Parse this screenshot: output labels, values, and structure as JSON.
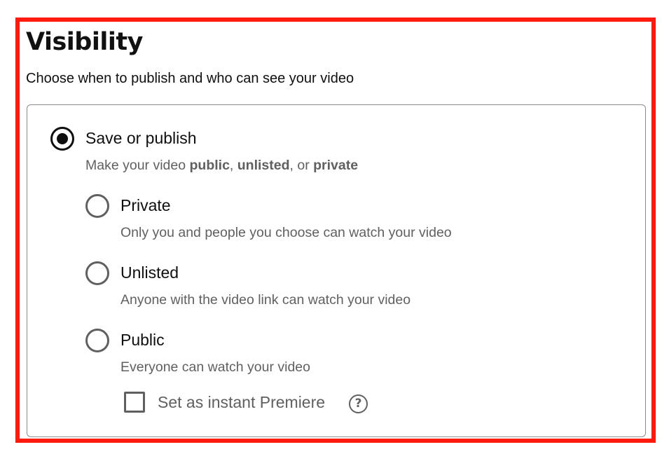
{
  "visibility": {
    "title": "Visibility",
    "subtitle": "Choose when to publish and who can see your video"
  },
  "save_or_publish": {
    "label": "Save or publish",
    "selected": true,
    "desc_prefix": "Make your video ",
    "desc_public": "public",
    "desc_sep1": ", ",
    "desc_unlisted": "unlisted",
    "desc_sep2": ", or ",
    "desc_private": "private"
  },
  "options": [
    {
      "label": "Private",
      "description": "Only you and people you choose can watch your video",
      "selected": false
    },
    {
      "label": "Unlisted",
      "description": "Anyone with the video link can watch your video",
      "selected": false
    },
    {
      "label": "Public",
      "description": "Everyone can watch your video",
      "selected": false
    }
  ],
  "premiere": {
    "label": "Set as instant Premiere",
    "checked": false,
    "help_icon": "help-circle-icon",
    "help_glyph": "?"
  },
  "colors": {
    "highlight_border": "#ff1a0d",
    "primary_text": "#0f0f0f",
    "secondary_text": "#606060"
  }
}
